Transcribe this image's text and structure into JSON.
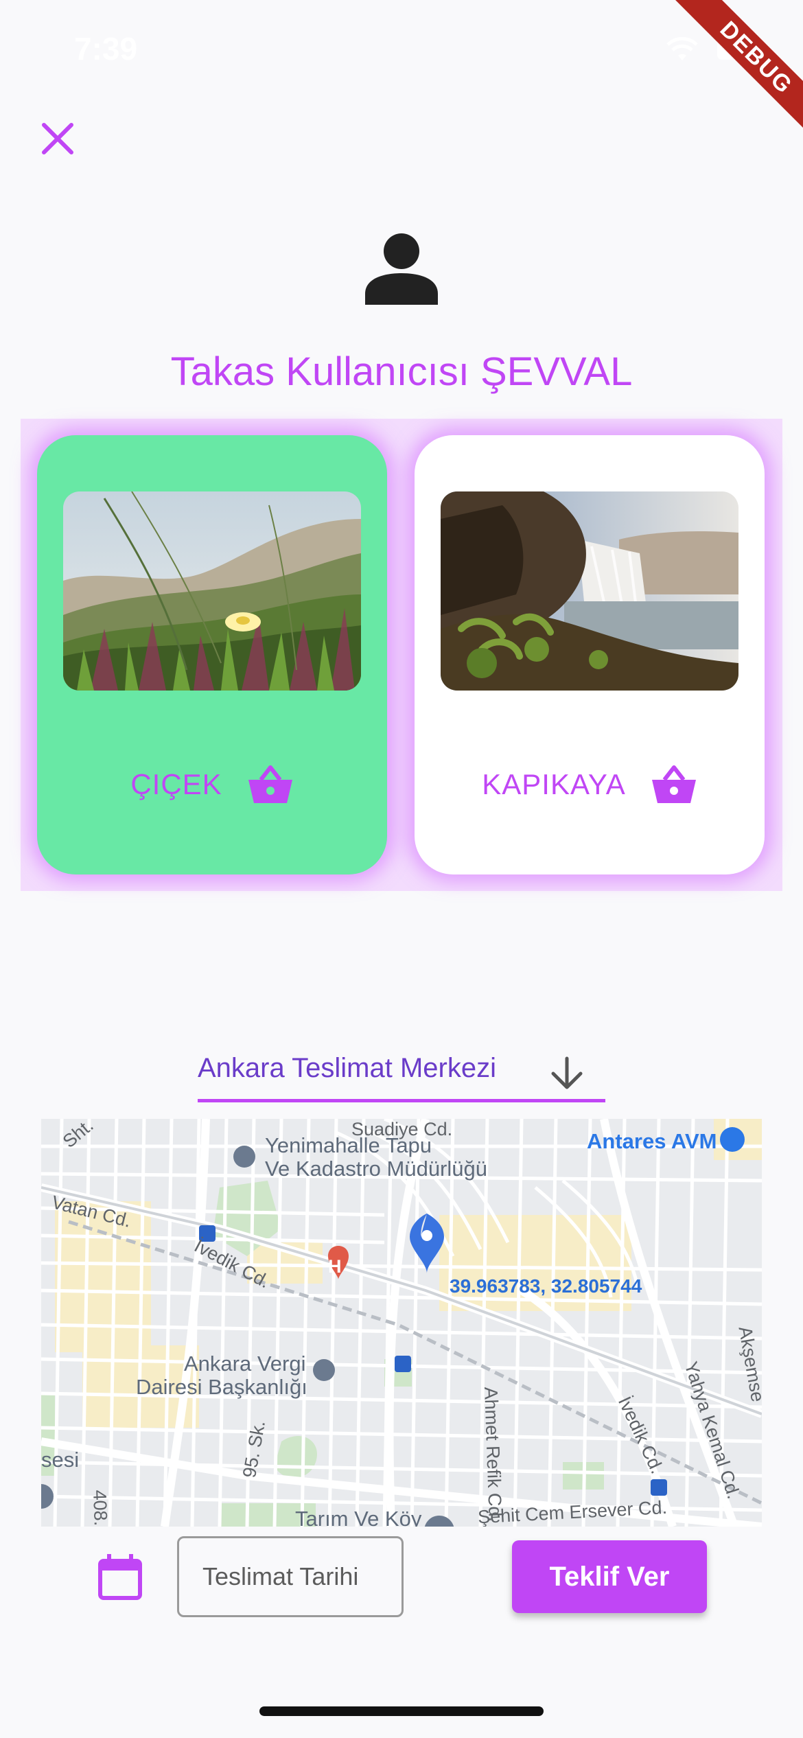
{
  "status_bar": {
    "time": "7:39"
  },
  "debug_banner": "DEBUG",
  "header": {
    "close_icon": "close-icon",
    "avatar_icon": "person-icon",
    "title": "Takas Kullanıcısı ŞEVVAL"
  },
  "cards": [
    {
      "label": "ÇIÇEK",
      "photo": "flower-dunes-photo",
      "icon": "basket-icon",
      "background": "#68e8a5",
      "selected": true
    },
    {
      "label": "KAPIKAYA",
      "photo": "waterfall-photo",
      "icon": "basket-icon",
      "background": "#ffffff",
      "selected": false
    }
  ],
  "delivery": {
    "selected": "Ankara Teslimat Merkezi",
    "arrow_icon": "arrow-down-icon"
  },
  "map": {
    "coordinates": "39.963783, 32.805744",
    "labels": {
      "suadiye": "Suadiye Cd.",
      "antares": "Antares AVM",
      "tapu_line1": "Yenimahalle Tapu",
      "tapu_line2": "Ve Kadastro Müdürlüğü",
      "vatan": "Vatan Cd.",
      "ivedik": "İvedik Cd.",
      "vergi_line1": "Ankara Vergi",
      "vergi_line2": "Dairesi Başkanlığı",
      "ahmet": "Ahmet Refik Cd.",
      "ivedik2": "İvedik Cd.",
      "yahya": "Yahya Kemal Cd.",
      "aksemsettin": "Akşemse",
      "sk95": "95. Sk.",
      "sesi": "sesi",
      "sk408": "408.",
      "sehit": "Şehit Cem Ersever Cd.",
      "tarim": "Tarım Ve Köy",
      "sht": "Sht.",
      "hospital": "H",
      "metro": "M"
    }
  },
  "bottom": {
    "calendar_icon": "calendar-icon",
    "date_placeholder": "Teslimat Tarihi",
    "offer_button": "Teklif Ver"
  },
  "colors": {
    "accent": "#c046f5",
    "card_selected": "#68e8a5",
    "dropdown_text": "#6a3cc9"
  }
}
